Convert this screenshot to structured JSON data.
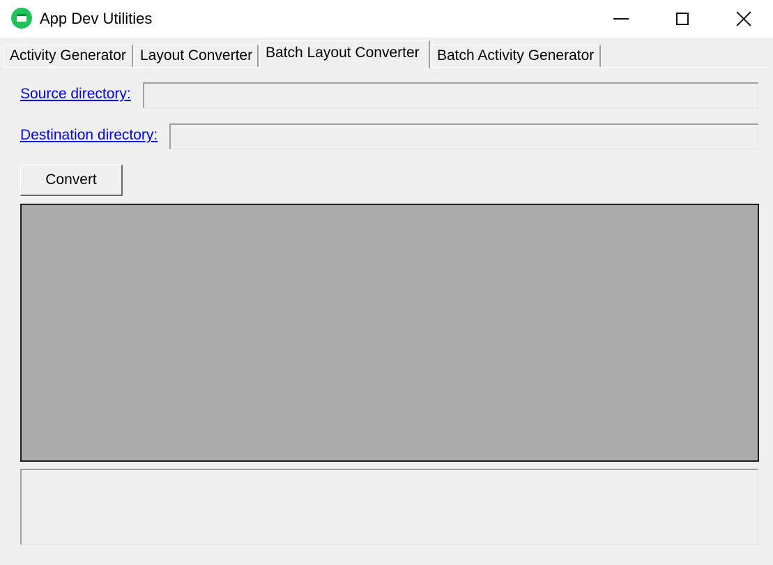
{
  "window": {
    "title": "App Dev Utilities",
    "icon": "app-icon-green"
  },
  "tabs": [
    {
      "label": "Activity Generator",
      "active": false
    },
    {
      "label": "Layout Converter",
      "active": false
    },
    {
      "label": "Batch Layout Converter",
      "active": true
    },
    {
      "label": "Batch Activity Generator",
      "active": false
    }
  ],
  "form": {
    "source_label": "Source directory:",
    "source_value": "",
    "destination_label": "Destination directory:",
    "destination_value": "",
    "convert_label": "Convert",
    "log_value": ""
  },
  "colors": {
    "link": "#0000ff",
    "panel": "#ababab",
    "window_bg": "#f0f0f0",
    "app_icon": "#1ec35a"
  }
}
